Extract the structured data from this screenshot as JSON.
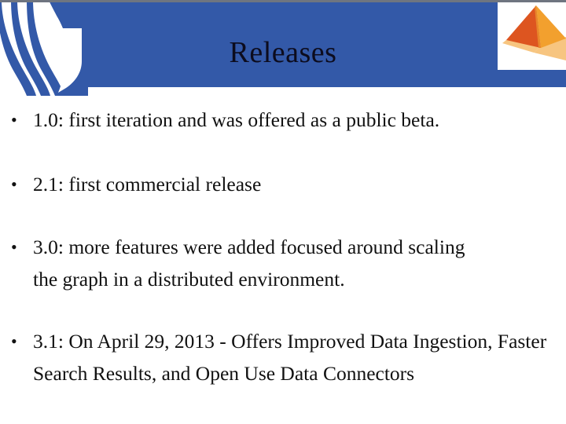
{
  "slide": {
    "title": "Releases",
    "bullet_marker": "•",
    "bullets": [
      {
        "text": "1.0: first iteration and was offered as a public beta."
      },
      {
        "text": "2.1: first commercial release"
      },
      {
        "text": "3.0: more features were added focused around scaling the graph in a distributed environment."
      },
      {
        "text": "3.1: On April 29, 2013 - Offers Improved Data Ingestion, Faster Search Results, and Open Use Data Connectors"
      }
    ]
  },
  "branding": {
    "wave_logo_name": "wave-ribbon-logo",
    "pyramid_logo_name": "pyramid-logo"
  },
  "colors": {
    "header_blue": "#3359a8",
    "top_edge_gray": "#6f7580",
    "title_text": "#0c0c1e",
    "body_text": "#111111",
    "page_background": "#ffffff",
    "pyramid_left_face": "#dd5520",
    "pyramid_right_face": "#f2a02e",
    "pyramid_shadow": "#f7c580",
    "pyramid_base_shade": "#e8862a"
  }
}
